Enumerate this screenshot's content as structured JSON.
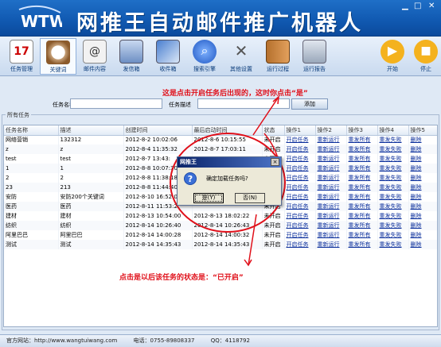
{
  "app": {
    "title": "网推王自动邮件推广机器人",
    "logo_text": "WTW"
  },
  "toolbar": {
    "items": [
      {
        "label": "任务管理",
        "icon": "calendar-icon"
      },
      {
        "label": "关键词",
        "icon": "coffee-icon"
      },
      {
        "label": "邮件内容",
        "icon": "mail-content-icon"
      },
      {
        "label": "发信箱",
        "icon": "outbox-icon"
      },
      {
        "label": "收件箱",
        "icon": "inbox-icon"
      },
      {
        "label": "搜索引擎",
        "icon": "search-icon"
      },
      {
        "label": "其他设置",
        "icon": "tools-icon"
      },
      {
        "label": "运行过程",
        "icon": "book-icon"
      },
      {
        "label": "运行报告",
        "icon": "report-icon"
      },
      {
        "label": "开始",
        "icon": "play-icon"
      },
      {
        "label": "停止",
        "icon": "stop-icon"
      }
    ]
  },
  "form": {
    "task_name_label": "任务名称",
    "task_desc_label": "任务描述",
    "task_name_value": "",
    "task_desc_value": "",
    "add_button": "添加"
  },
  "group_title": "所有任务",
  "table": {
    "headers": [
      "任务名称",
      "描述",
      "创建时间",
      "最后启动时间",
      "状态",
      "操作1",
      "操作2",
      "操作3",
      "操作4",
      "操作5"
    ],
    "rows": [
      [
        "网络营销",
        "132312",
        "2012-8-2 10:02:06",
        "2012-8-6 10:15:55",
        "未开启",
        "开启任务",
        "重新运行",
        "重发所有",
        "重发失败",
        "删除"
      ],
      [
        "z",
        "z",
        "2012-8-4 11:35:32",
        "2012-8-7 17:03:11",
        "未开启",
        "开启任务",
        "重新运行",
        "重发所有",
        "重发失败",
        "删除"
      ],
      [
        "test",
        "test",
        "2012-8-7 13:43:",
        "",
        "未开启",
        "开启任务",
        "重新运行",
        "重发所有",
        "重发失败",
        "删除"
      ],
      [
        "1",
        "1",
        "2012-8-8 10:07:30",
        "",
        "未开启",
        "开启任务",
        "重新运行",
        "重发所有",
        "重发失败",
        "删除"
      ],
      [
        "2",
        "2",
        "2012-8-8 11:38:18",
        "",
        "未开启",
        "开启任务",
        "重新运行",
        "重发所有",
        "重发失败",
        "删除"
      ],
      [
        "23",
        "213",
        "2012-8-8 11:44:40",
        "",
        "未开启",
        "开启任务",
        "重新运行",
        "重发所有",
        "重发失败",
        "删除"
      ],
      [
        "安防",
        "安防200个关键词",
        "2012-8-10 16:52:0",
        "",
        "未开启",
        "开启任务",
        "重新运行",
        "重发所有",
        "重发失败",
        "删除"
      ],
      [
        "医药",
        "医药",
        "2012-8-11 11:53:2",
        "",
        "未开启",
        "开启任务",
        "重新运行",
        "重发所有",
        "重发失败",
        "删除"
      ],
      [
        "建材",
        "建材",
        "2012-8-13 10:54:00",
        "2012-8-13 18:02:22",
        "未开启",
        "开启任务",
        "重新运行",
        "重发所有",
        "重发失败",
        "删除"
      ],
      [
        "纺织",
        "纺织",
        "2012-8-14 10:26:40",
        "2012-8-14 10:26:43",
        "未开启",
        "开启任务",
        "重新运行",
        "重发所有",
        "重发失败",
        "删除"
      ],
      [
        "阿里巴巴",
        "阿里巴巴",
        "2012-8-14 14:00:28",
        "2012-8-14 14:00:32",
        "未开启",
        "开启任务",
        "重新运行",
        "重发所有",
        "重发失败",
        "删除"
      ],
      [
        "测试",
        "测试",
        "2012-8-14 14:35:43",
        "2012-8-14 14:35:43",
        "未开启",
        "开启任务",
        "重新运行",
        "重发所有",
        "重发失败",
        "删除"
      ]
    ]
  },
  "annotations": {
    "top": "这是点击开启任务后出现的，这时你点击“是”",
    "bottom": "点击是以后该任务的状态是：“已开启”"
  },
  "dialog": {
    "title": "网推王",
    "message": "确定加载任务吗?",
    "yes": "是(Y)",
    "no": "否(N)",
    "close": "×"
  },
  "statusbar": {
    "website": "官方网站：http://www.wangtuiwang.com",
    "phone": "电话：0755-89808337",
    "qq": "QQ：4118792"
  },
  "colors": {
    "accent": "#1058b0",
    "annotation": "#e0101a"
  }
}
